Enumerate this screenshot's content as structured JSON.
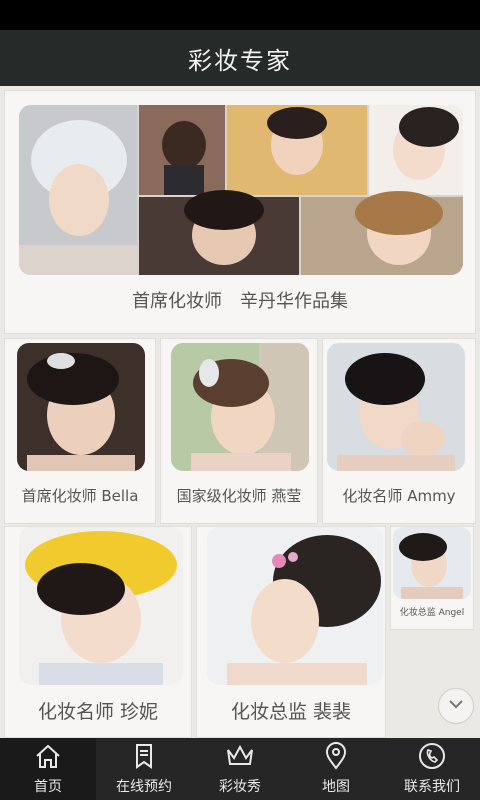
{
  "header": {
    "title": "彩妆专家"
  },
  "cards": {
    "featured": {
      "caption": "首席化妆师　辛丹华作品集"
    },
    "bella": {
      "caption": "首席化妆师 Bella"
    },
    "yanying": {
      "caption": "国家级化妆师 燕莹"
    },
    "ammy": {
      "caption": "化妆名师 Ammy"
    },
    "zhenni": {
      "caption": "化妆名师 珍妮"
    },
    "peipei": {
      "caption": "化妆总监 裴裴"
    },
    "angel": {
      "caption": "化妆总监 Angel"
    }
  },
  "tabs": [
    {
      "label": "首页",
      "icon": "home-icon"
    },
    {
      "label": "在线预约",
      "icon": "bookmark-icon"
    },
    {
      "label": "彩妆秀",
      "icon": "crown-icon"
    },
    {
      "label": "地图",
      "icon": "map-pin-icon"
    },
    {
      "label": "联系我们",
      "icon": "phone-icon"
    }
  ]
}
